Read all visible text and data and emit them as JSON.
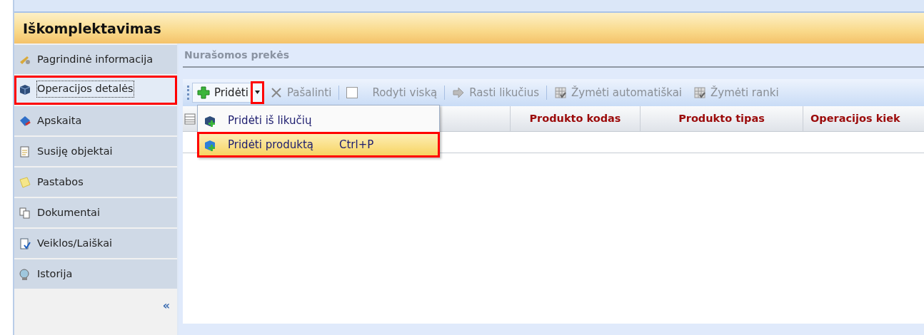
{
  "window": {
    "title": "Iškomplektavimas"
  },
  "sidebar": {
    "items": [
      {
        "label": "Pagrindinė informacija",
        "selected": false,
        "highlighted": false
      },
      {
        "label": "Operacijos detalės",
        "selected": true,
        "highlighted": true
      },
      {
        "label": "Apskaita",
        "selected": false,
        "highlighted": false
      },
      {
        "label": "Susiję objektai",
        "selected": false,
        "highlighted": false
      },
      {
        "label": "Pastabos",
        "selected": false,
        "highlighted": false
      },
      {
        "label": "Dokumentai",
        "selected": false,
        "highlighted": false
      },
      {
        "label": "Veiklos/Laiškai",
        "selected": false,
        "highlighted": false
      },
      {
        "label": "Istorija",
        "selected": false,
        "highlighted": false
      }
    ],
    "collapse": "«"
  },
  "section_title": "Nurašomos prekės",
  "toolbar": [
    {
      "kind": "split",
      "label": "Pridėti",
      "disabled": false,
      "arrow_highlighted": true
    },
    {
      "kind": "button",
      "label": "Pašalinti",
      "disabled": true
    },
    {
      "kind": "separator"
    },
    {
      "kind": "check",
      "label": "Rodyti viską",
      "checked": false,
      "disabled": true
    },
    {
      "kind": "separator"
    },
    {
      "kind": "button",
      "label": "Rasti likučius",
      "disabled": true
    },
    {
      "kind": "separator"
    },
    {
      "kind": "button",
      "label": "Žymėti automatiškai",
      "disabled": true
    },
    {
      "kind": "button",
      "label": "Žymėti ranki",
      "disabled": true
    }
  ],
  "dropdown": {
    "items": [
      {
        "label": "Pridėti iš likučių",
        "selected": false,
        "highlighted": false
      },
      {
        "label": "Pridėti produktą",
        "shortcut": "Ctrl+P",
        "selected": true,
        "highlighted": true
      }
    ]
  },
  "table": {
    "columns": [
      "Produkto kodas",
      "Produkto tipas",
      "Operacijos kiek"
    ]
  }
}
